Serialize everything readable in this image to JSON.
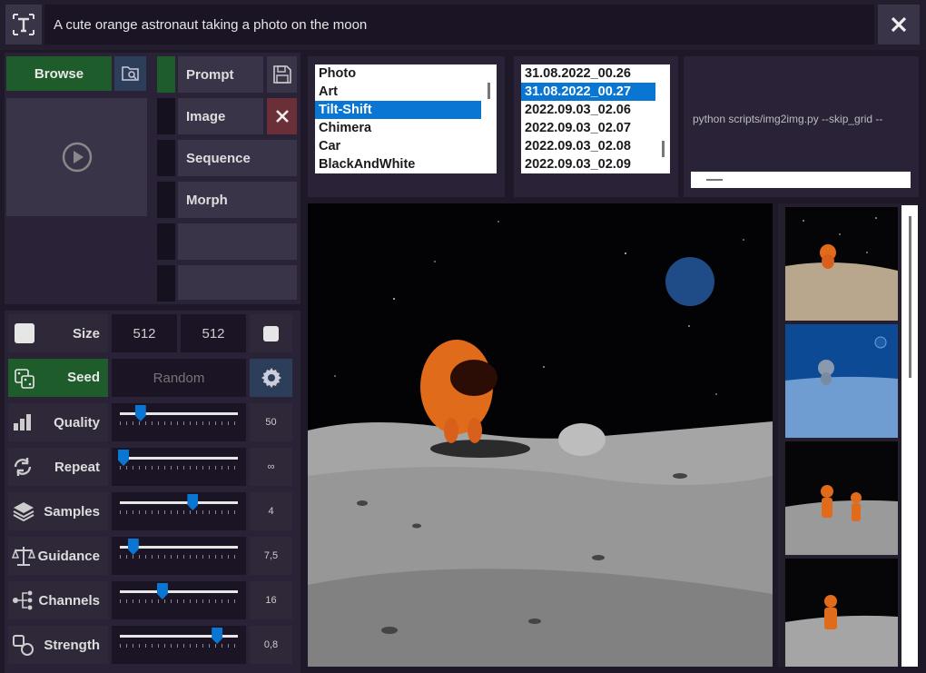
{
  "prompt": {
    "value": "A cute orange astronaut taking a photo on the moon"
  },
  "buttons": {
    "browse": "Browse",
    "prompt": "Prompt",
    "image": "Image",
    "sequence": "Sequence",
    "morph": "Morph"
  },
  "styles": {
    "items": [
      "Photo",
      "Art",
      "Tilt-Shift",
      "Chimera",
      "Car",
      "BlackAndWhite"
    ],
    "selected": "Tilt-Shift"
  },
  "history": {
    "items": [
      "31.08.2022_00.26",
      "31.08.2022_00.27",
      "2022.09.03_02.06",
      "2022.09.03_02.07",
      "2022.09.03_02.08",
      "2022.09.03_02.09"
    ],
    "selected": "31.08.2022_00.27"
  },
  "console": {
    "command": "python scripts/img2img.py --skip_grid  --"
  },
  "size": {
    "label": "Size",
    "width": "512",
    "height": "512"
  },
  "seed": {
    "label": "Seed",
    "placeholder": "Random"
  },
  "sliders": [
    {
      "label": "Quality",
      "value_text": "50",
      "position": 0.17
    },
    {
      "label": "Repeat",
      "value_text": "∞",
      "position": 0.03
    },
    {
      "label": "Samples",
      "value_text": "4",
      "position": 0.6
    },
    {
      "label": "Guidance",
      "value_text": "7,5",
      "position": 0.11
    },
    {
      "label": "Channels",
      "value_text": "16",
      "position": 0.35
    },
    {
      "label": "Strength",
      "value_text": "0,8",
      "position": 0.8
    }
  ],
  "icons": {
    "text_tool": "text-cursor-icon",
    "close": "close-icon",
    "browse_folder": "folder-search-icon",
    "save": "floppy-disk-icon",
    "delete": "x-icon",
    "play": "play-icon",
    "settings": "gear-icon"
  },
  "colors": {
    "accent": "#0a76d4",
    "green": "#1f5c2b",
    "background": "#1e1828"
  }
}
